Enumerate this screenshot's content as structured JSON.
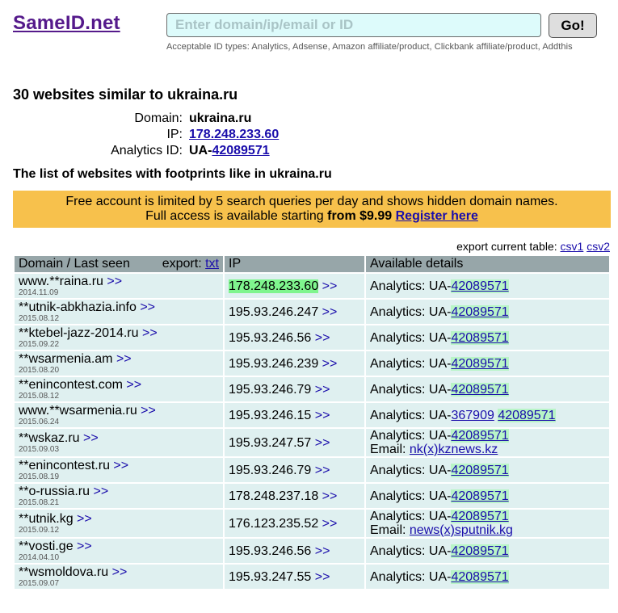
{
  "site": {
    "logo": "SameID.net"
  },
  "search": {
    "placeholder": "Enter domain/ip/email or ID",
    "button": "Go!",
    "id_types": "Acceptable ID types: Analytics, Adsense, Amazon affiliate/product, Clickbank affiliate/product, Addthis"
  },
  "summary": {
    "title": "30 websites similar to ukraina.ru",
    "domain_label": "Domain:",
    "domain_value": "ukraina.ru",
    "ip_label": "IP:",
    "ip_value": "178.248.233.60",
    "analytics_label": "Analytics ID:",
    "analytics_prefix": "UA-",
    "analytics_value": "42089571",
    "list_title": "The list of websites with footprints like in ukraina.ru"
  },
  "banner": {
    "line1": "Free account is limited by 5 search queries per day and shows hidden domain names.",
    "line2_prefix": "Full access is available starting ",
    "price": "from $9.99",
    "register": "Register here"
  },
  "export": {
    "label": "export current table:",
    "csv1": "csv1",
    "csv2": "csv2"
  },
  "table": {
    "header_domain": "Domain / Last seen",
    "header_export": "export:",
    "header_export_txt": "txt",
    "header_ip": "IP",
    "header_details": "Available details",
    "more": ">>",
    "analytics_prefix": "Analytics: UA-",
    "email_prefix": "Email: ",
    "rows": [
      {
        "domain": "www.**raina.ru",
        "date": "2014.11.09",
        "ip": "178.248.233.60",
        "ip_highlight": true,
        "ua_extra": "",
        "ua": "42089571",
        "email": ""
      },
      {
        "domain": "**utnik-abkhazia.info",
        "date": "2015.08.12",
        "ip": "195.93.246.247",
        "ip_highlight": false,
        "ua_extra": "",
        "ua": "42089571",
        "email": ""
      },
      {
        "domain": "**ktebel-jazz-2014.ru",
        "date": "2015.09.22",
        "ip": "195.93.246.56",
        "ip_highlight": false,
        "ua_extra": "",
        "ua": "42089571",
        "email": ""
      },
      {
        "domain": "**wsarmenia.am",
        "date": "2015.08.20",
        "ip": "195.93.246.239",
        "ip_highlight": false,
        "ua_extra": "",
        "ua": "42089571",
        "email": ""
      },
      {
        "domain": "**enincontest.com",
        "date": "2015.08.12",
        "ip": "195.93.246.79",
        "ip_highlight": false,
        "ua_extra": "",
        "ua": "42089571",
        "email": ""
      },
      {
        "domain": "www.**wsarmenia.ru",
        "date": "2015.06.24",
        "ip": "195.93.246.15",
        "ip_highlight": false,
        "ua_extra": "367909",
        "ua": "42089571",
        "email": ""
      },
      {
        "domain": "**wskaz.ru",
        "date": "2015.09.03",
        "ip": "195.93.247.57",
        "ip_highlight": false,
        "ua_extra": "",
        "ua": "42089571",
        "email": "nk(x)kznews.kz"
      },
      {
        "domain": "**enincontest.ru",
        "date": "2015.08.19",
        "ip": "195.93.246.79",
        "ip_highlight": false,
        "ua_extra": "",
        "ua": "42089571",
        "email": ""
      },
      {
        "domain": "**o-russia.ru",
        "date": "2015.08.21",
        "ip": "178.248.237.18",
        "ip_highlight": false,
        "ua_extra": "",
        "ua": "42089571",
        "email": ""
      },
      {
        "domain": "**utnik.kg",
        "date": "2015.09.12",
        "ip": "176.123.235.52",
        "ip_highlight": false,
        "ua_extra": "",
        "ua": "42089571",
        "email": "news(x)sputnik.kg"
      },
      {
        "domain": "**vosti.ge",
        "date": "2014.04.10",
        "ip": "195.93.246.56",
        "ip_highlight": false,
        "ua_extra": "",
        "ua": "42089571",
        "email": ""
      },
      {
        "domain": "**wsmoldova.ru",
        "date": "2015.09.07",
        "ip": "195.93.247.55",
        "ip_highlight": false,
        "ua_extra": "",
        "ua": "42089571",
        "email": ""
      }
    ]
  },
  "colors": {
    "logo": "#551a8b",
    "link": "#1a0dab",
    "search_bg": "#ddfbfb",
    "banner_bg": "#f7c14c",
    "header_bg": "#97a6a9",
    "cell_bg": "#dff0f0",
    "ip_highlight": "#7ff58e",
    "ua_highlight": "#b8f5c7"
  }
}
